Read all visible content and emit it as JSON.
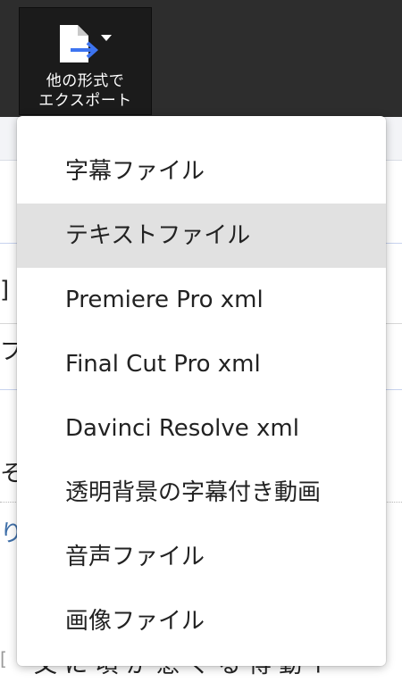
{
  "toolbar": {
    "export_button": {
      "label_line1": "他の形式で",
      "label_line2": "エクスポート",
      "icon": "file-export-icon"
    }
  },
  "background": {
    "fragments": [
      "]",
      "プ",
      "そり",
      "り",
      "[",
      "文 に 頃 か 恵 ぐ る 得 動 ト"
    ]
  },
  "export_menu": {
    "selected_index": 1,
    "items": [
      {
        "label": "字幕ファイル"
      },
      {
        "label": "テキストファイル"
      },
      {
        "label": "Premiere Pro xml"
      },
      {
        "label": "Final Cut Pro xml"
      },
      {
        "label": "Davinci Resolve xml"
      },
      {
        "label": "透明背景の字幕付き動画"
      },
      {
        "label": "音声ファイル"
      },
      {
        "label": "画像ファイル"
      }
    ]
  },
  "colors": {
    "toolbar_bg": "#2d2d2d",
    "button_bg": "#1b1b1b",
    "accent_arrow": "#3d74f0",
    "selected_bg": "#e1e1e1"
  }
}
